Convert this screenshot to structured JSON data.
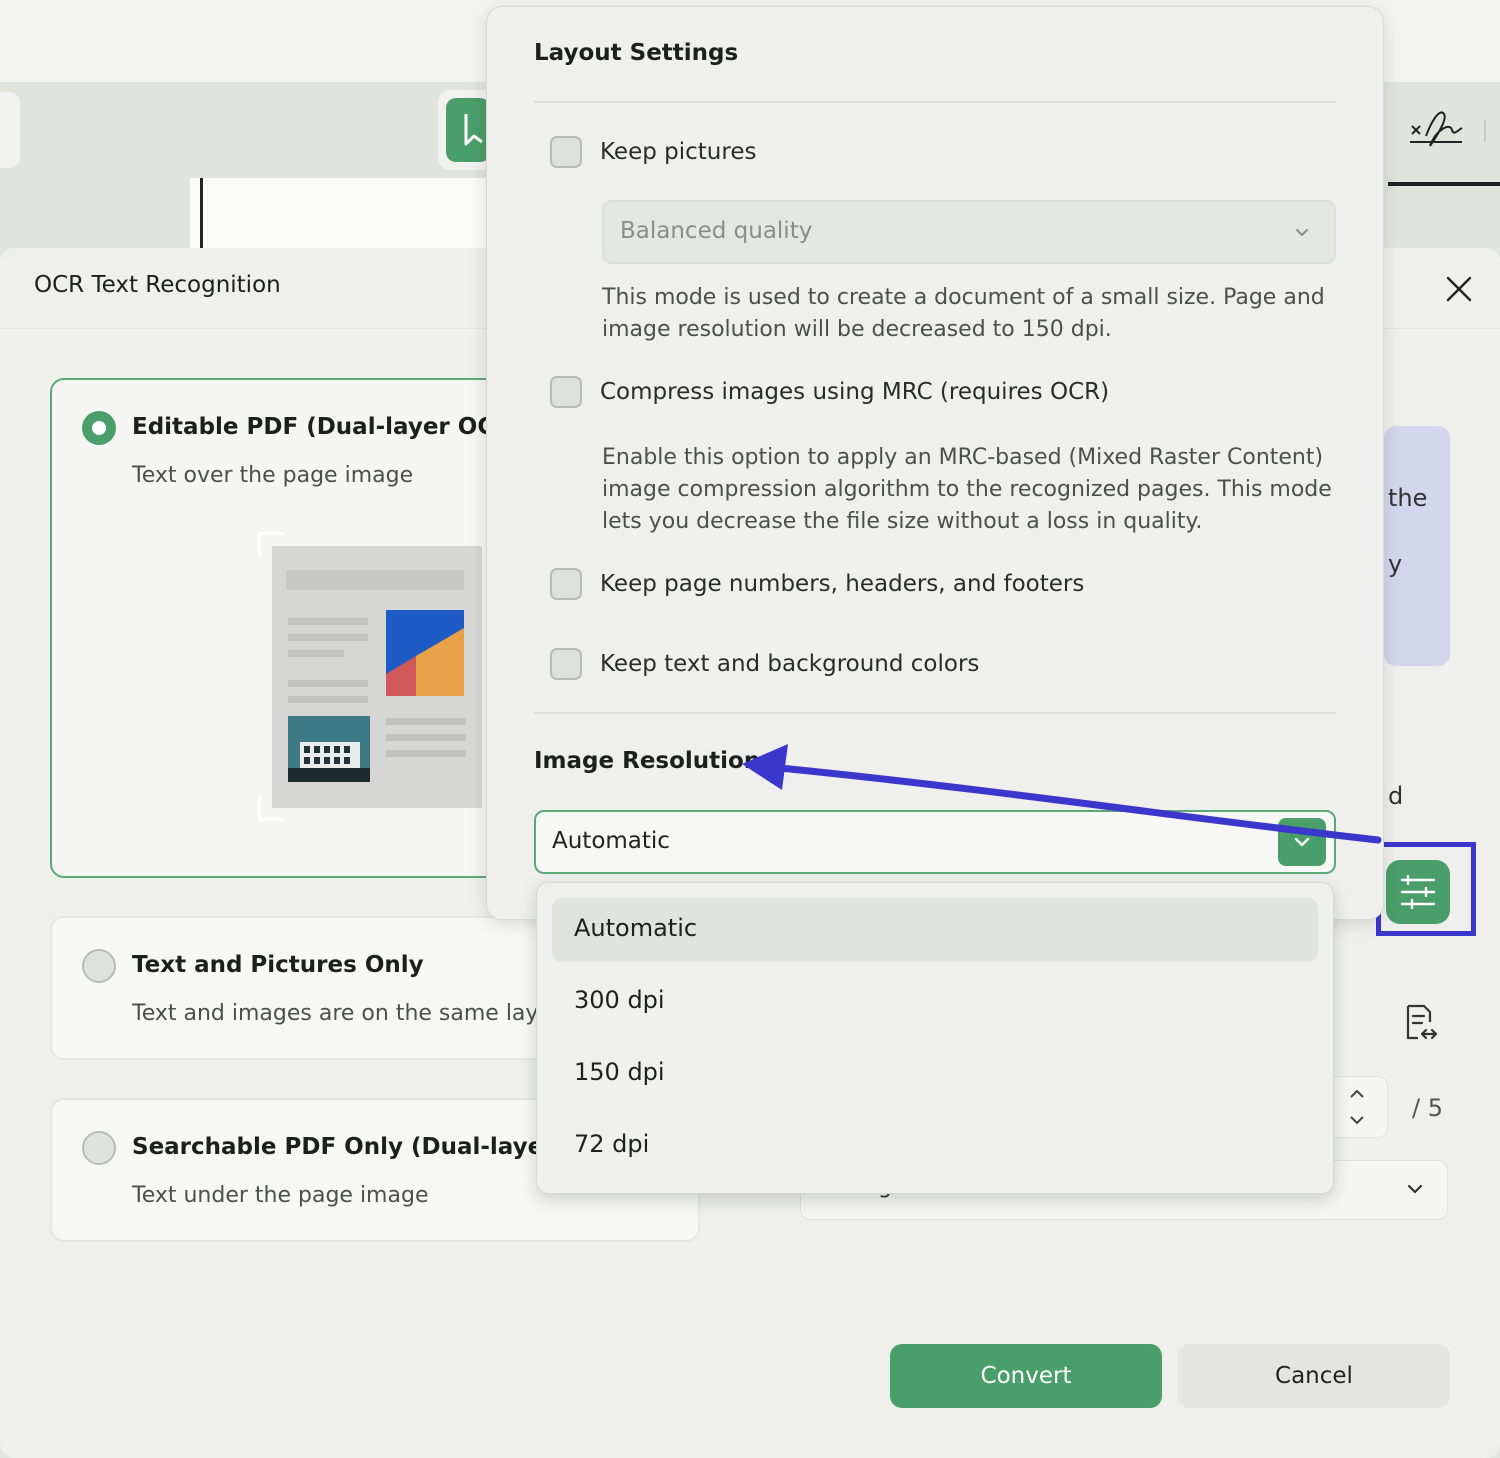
{
  "dialog": {
    "title": "OCR Text Recognition"
  },
  "options": [
    {
      "title": "Editable PDF (Dual-layer OCR)",
      "subtitle": "Text over the page image",
      "selected": true
    },
    {
      "title": "Text and Pictures Only",
      "subtitle": "Text and images are on the same layer.",
      "selected": false
    },
    {
      "title": "Searchable PDF Only (Dual-layer OCR",
      "subtitle": "Text under the page image",
      "selected": false
    }
  ],
  "layout_settings": {
    "title": "Layout Settings",
    "keep_pictures": {
      "label": "Keep pictures",
      "checked": false
    },
    "quality": {
      "value": "Balanced quality"
    },
    "quality_description": "This mode is used to create a document of a small size. Page and image resolution will be decreased to 150 dpi.",
    "compress_mrc": {
      "label": "Compress images using MRC (requires OCR)",
      "checked": false
    },
    "mrc_description": "Enable this option to apply an MRC-based (Mixed Raster Content) image compression algorithm to the recognized pages. This mode lets you decrease the file size without a loss in quality.",
    "keep_headers": {
      "label": "Keep page numbers, headers, and footers",
      "checked": false
    },
    "keep_colors": {
      "label": "Keep text and background colors",
      "checked": false
    }
  },
  "image_resolution": {
    "title": "Image Resolution",
    "value": "Automatic",
    "options": [
      "Automatic",
      "300 dpi",
      "150 dpi",
      "72 dpi"
    ],
    "highlighted": "Automatic"
  },
  "right_panel": {
    "partial_text_1": "the",
    "partial_text_2": "y",
    "partial_text_3": "d",
    "page_total": "/ 5",
    "page_range": "All Pages"
  },
  "buttons": {
    "convert": "Convert",
    "cancel": "Cancel"
  },
  "colors": {
    "accent": "#4a9e6a",
    "annotation": "#3c37cc"
  }
}
